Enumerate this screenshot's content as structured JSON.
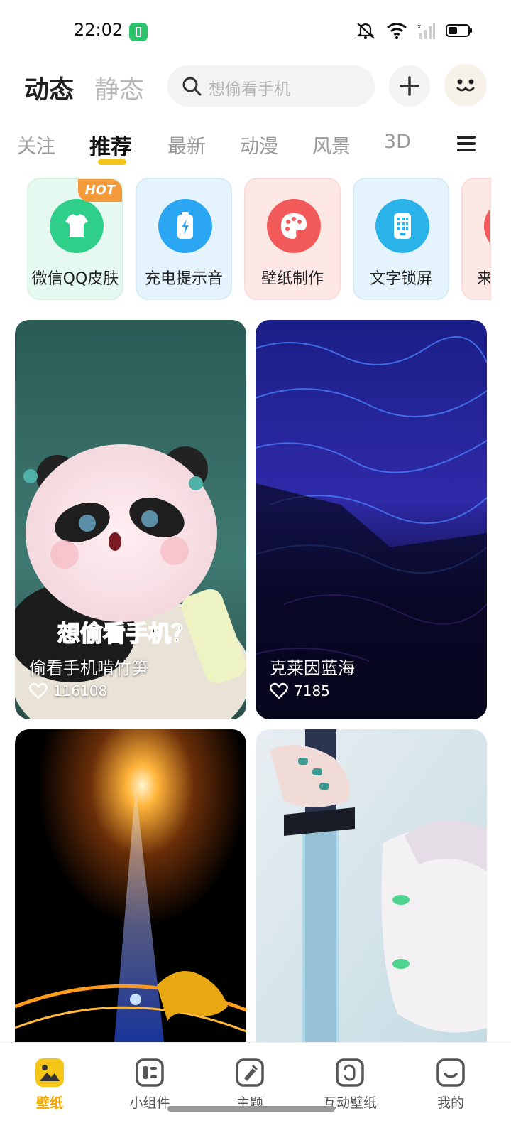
{
  "status_bar": {
    "time": "22:02"
  },
  "header": {
    "mode_tabs": [
      "动态",
      "静态"
    ],
    "search_placeholder": "想偷看手机"
  },
  "category_tabs": [
    "关注",
    "推荐",
    "最新",
    "动漫",
    "风景",
    "3D"
  ],
  "active_category": "推荐",
  "features": [
    {
      "label": "微信QQ皮肤",
      "badge": "HOT",
      "bg": "#e6f9f1",
      "icon_color": "#2fcf8a",
      "icon": "shirt-icon"
    },
    {
      "label": "充电提示音",
      "bg": "#e5f4fc",
      "icon_color": "#2aa6f2",
      "icon": "battery-icon"
    },
    {
      "label": "壁纸制作",
      "bg": "#fde8e6",
      "icon_color": "#f25a5a",
      "icon": "palette-icon"
    },
    {
      "label": "文字锁屏",
      "bg": "#e5f4fc",
      "icon_color": "#2ab3e8",
      "icon": "keypad-icon"
    },
    {
      "label": "来",
      "bg": "#fde8e6",
      "icon_color": "#f25a5a",
      "icon": "partial-icon"
    }
  ],
  "wallpapers": [
    {
      "title": "偷看手机啃竹笋",
      "likes": "116108",
      "overlay_text": "想偷看手机？"
    },
    {
      "title": "克莱因蓝海",
      "likes": "7185"
    },
    {
      "title": "",
      "likes": ""
    },
    {
      "title": "",
      "likes": ""
    }
  ],
  "bottom_nav": [
    {
      "label": "壁纸",
      "icon": "wallpaper-icon",
      "active": true
    },
    {
      "label": "小组件",
      "icon": "widget-icon",
      "active": false
    },
    {
      "label": "主题",
      "icon": "theme-icon",
      "active": false
    },
    {
      "label": "互动壁纸",
      "icon": "interactive-wallpaper-icon",
      "active": false
    },
    {
      "label": "我的",
      "icon": "profile-icon",
      "active": false
    }
  ],
  "colors": {
    "accent": "#f5c518",
    "active_nav": "#f0a800"
  }
}
